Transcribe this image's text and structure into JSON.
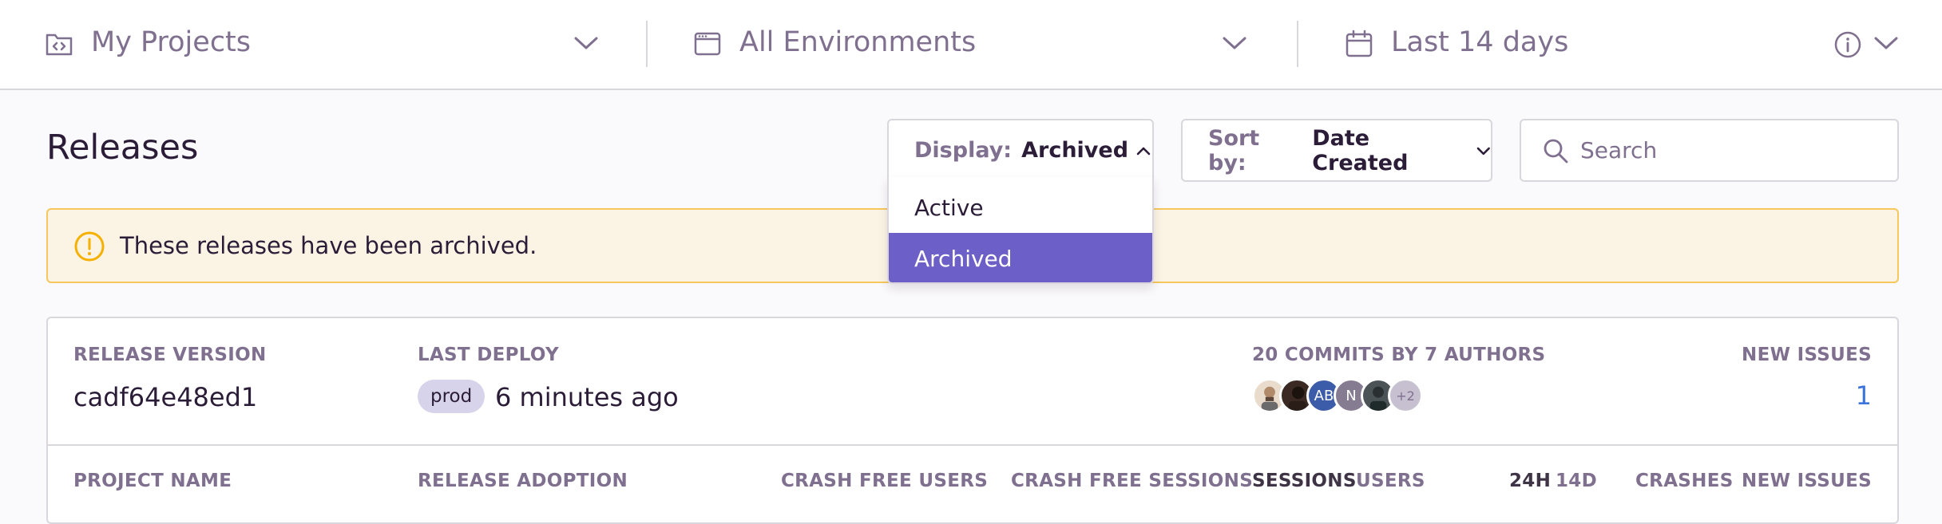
{
  "topbar": {
    "projects_label": "My Projects",
    "environments_label": "All Environments",
    "date_label": "Last 14 days"
  },
  "page": {
    "title": "Releases"
  },
  "display_control": {
    "label": "Display:",
    "value": "Archived",
    "options": [
      "Active",
      "Archived"
    ],
    "selected": "Archived"
  },
  "sort_control": {
    "label": "Sort by:",
    "value": "Date Created"
  },
  "search": {
    "placeholder": "Search"
  },
  "banner": {
    "text": "These releases have been archived."
  },
  "release": {
    "version_header": "RELEASE VERSION",
    "version": "cadf64e48ed1",
    "deploy_header": "LAST DEPLOY",
    "environment": "prod",
    "deploy_time": "6 minutes ago",
    "commits_header": "20 COMMITS BY 7 AUTHORS",
    "authors": [
      {
        "type": "photo",
        "color": "#e9dccd"
      },
      {
        "type": "photo",
        "color": "#3b2a24"
      },
      {
        "type": "initials",
        "text": "AB",
        "color": "#3c5ba8"
      },
      {
        "type": "initials",
        "text": "N",
        "color": "#857c91"
      },
      {
        "type": "photo",
        "color": "#4b5357"
      },
      {
        "type": "more",
        "text": "+2",
        "color": "#c6c0d0"
      }
    ],
    "new_issues_header": "NEW ISSUES",
    "new_issues": "1"
  },
  "table_headers": {
    "project_name": "PROJECT NAME",
    "release_adoption": "RELEASE ADOPTION",
    "crash_free_users": "CRASH FREE USERS",
    "crash_free_sessions": "CRASH FREE SESSIONS",
    "sessions": "SESSIONS",
    "users": "USERS",
    "period_24h": "24H",
    "period_14d": "14D",
    "crashes": "CRASHES",
    "new_issues": "NEW ISSUES"
  },
  "colors": {
    "accent": "#6c5fc7",
    "link": "#3d74db",
    "warning": "#f5b000",
    "warning_bg": "#fbf4e4"
  }
}
